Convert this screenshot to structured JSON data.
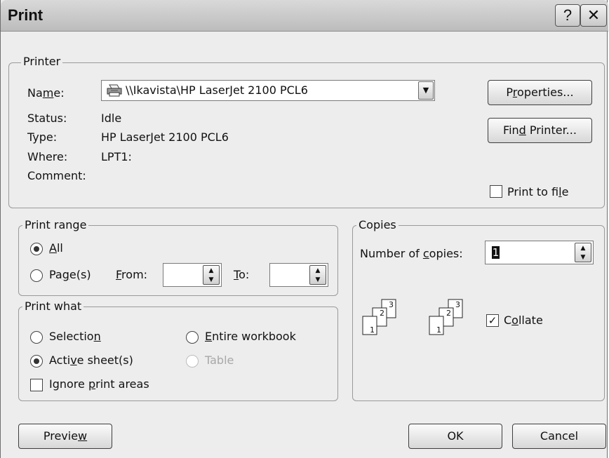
{
  "window": {
    "title": "Print",
    "help_glyph": "?",
    "close_glyph": "✕"
  },
  "printer": {
    "legend": "Printer",
    "name_label": "Name:",
    "name_value": "\\\\Ikavista\\HP LaserJet 2100 PCL6",
    "status_label": "Status:",
    "status_value": "Idle",
    "type_label": "Type:",
    "type_value": "HP LaserJet 2100 PCL6",
    "where_label": "Where:",
    "where_value": "LPT1:",
    "comment_label": "Comment:",
    "properties_button": "Properties...",
    "find_printer_button": "Find Printer...",
    "print_to_file_label": "Print to file",
    "print_to_file_checked": false,
    "printer_icon": "printer-icon"
  },
  "print_range": {
    "legend": "Print range",
    "all_label": "All",
    "pages_label": "Page(s)",
    "from_label": "From:",
    "to_label": "To:",
    "from_value": "",
    "to_value": "",
    "selected": "All"
  },
  "print_what": {
    "legend": "Print what",
    "selection_label": "Selection",
    "entire_workbook_label": "Entire workbook",
    "active_sheets_label": "Active sheet(s)",
    "table_label": "Table",
    "ignore_print_areas_label": "Ignore print areas",
    "selected": "Active sheet(s)",
    "ignore_print_areas_checked": false
  },
  "copies": {
    "legend": "Copies",
    "number_label": "Number of copies:",
    "number_value": "1",
    "collate_label": "Collate",
    "collate_checked": true,
    "collate_icon": "collate-pages-icon"
  },
  "buttons": {
    "preview": "Preview",
    "ok": "OK",
    "cancel": "Cancel"
  },
  "colors": {
    "dialog_bg": "#ededed",
    "title_bar": "#c8c8c8"
  }
}
